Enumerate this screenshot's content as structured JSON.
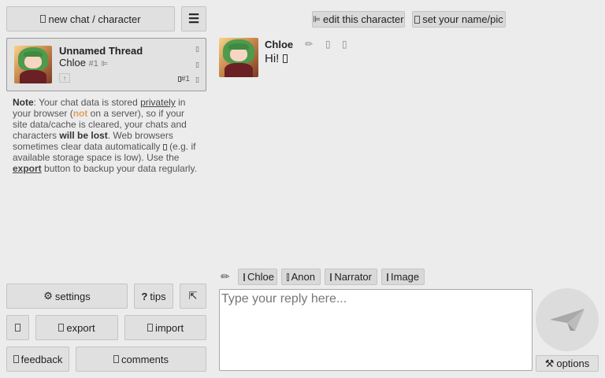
{
  "colors": {
    "background": "#ececec",
    "warn": "#e0a060",
    "button": "#e0e0e0"
  },
  "sidebar": {
    "new_chat_label": "new chat / character",
    "menu_icon": "hamburger-icon",
    "thread": {
      "title": "Unnamed Thread",
      "character": "Chloe",
      "number": "#1",
      "count_label": "#1",
      "up_label": "↑"
    },
    "note": {
      "lead": "Note",
      "p1": ": Your chat data is stored ",
      "privately": "privately",
      "p2": " in your browser (",
      "not": "not",
      "p3": " on a server), so if your site data/cache is cleared, your chats and characters ",
      "will_be_lost": "will be lost",
      "p4": ". Web browsers sometimes clear data automatically",
      "p5": " (e.g. if available storage space is low). Use the ",
      "export_word": "export",
      "p6": " button to backup your data regularly."
    },
    "buttons": {
      "settings": "settings",
      "tips": "tips",
      "export": "export",
      "import": "import",
      "feedback": "feedback",
      "comments": "comments"
    }
  },
  "header": {
    "edit_character": "edit this character",
    "set_name": "set your name/pic"
  },
  "message": {
    "author": "Chloe",
    "text": "Hi!"
  },
  "composer": {
    "pencil_icon": "pencil-icon",
    "quick_buttons": [
      "Chloe",
      "Anon",
      "Narrator",
      "Image"
    ],
    "placeholder": "Type your reply here...",
    "options_label": "options"
  }
}
